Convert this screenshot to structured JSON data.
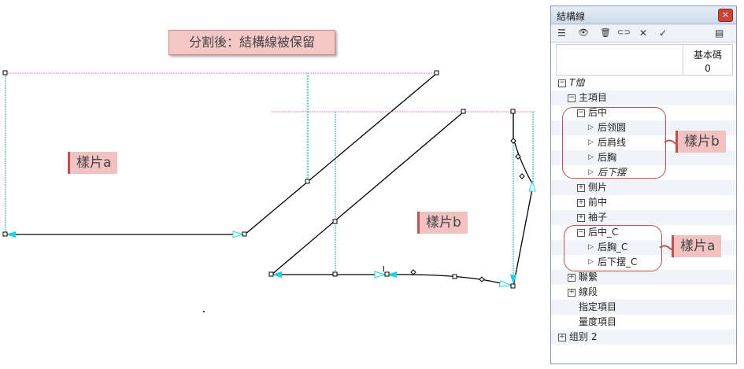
{
  "annotations": {
    "title": "分割後：結構線被保留",
    "piece_a_canvas": "樣片a",
    "piece_b_canvas": "樣片b",
    "piece_b_panel": "樣片b",
    "piece_a_panel": "樣片a"
  },
  "panel": {
    "title": "結構線",
    "close": "×",
    "toolbar": {
      "list": "☰",
      "eye": "👁",
      "trash": "🗑",
      "link": "⊂⊃",
      "delete": "✕",
      "check": "✓",
      "menu": "▤"
    },
    "column": {
      "label": "基本碼",
      "value": "0"
    },
    "tree": [
      {
        "label": "T恤",
        "level": 0,
        "type": "minus",
        "italic": true
      },
      {
        "label": "主項目",
        "level": 1,
        "type": "minus"
      },
      {
        "label": "后中",
        "level": 2,
        "type": "minus"
      },
      {
        "label": "后领圆",
        "level": 3,
        "type": "tri"
      },
      {
        "label": "后肩线",
        "level": 3,
        "type": "tri"
      },
      {
        "label": "后胸",
        "level": 3,
        "type": "tri"
      },
      {
        "label": "后下摆",
        "level": 3,
        "type": "tri",
        "italic": true
      },
      {
        "label": "侧片",
        "level": 2,
        "type": "plus"
      },
      {
        "label": "前中",
        "level": 2,
        "type": "plus"
      },
      {
        "label": "袖子",
        "level": 2,
        "type": "plus"
      },
      {
        "label": "后中_C",
        "level": 2,
        "type": "minus"
      },
      {
        "label": "后胸_C",
        "level": 3,
        "type": "tri"
      },
      {
        "label": "后下摆_C",
        "level": 3,
        "type": "tri"
      },
      {
        "label": "聯繫",
        "level": 1,
        "type": "plus"
      },
      {
        "label": "線段",
        "level": 1,
        "type": "plus"
      },
      {
        "label": "指定項目",
        "level": 1,
        "type": "none"
      },
      {
        "label": "量度項目",
        "level": 1,
        "type": "none"
      },
      {
        "label": "组别 2",
        "level": 0,
        "type": "plus"
      }
    ]
  }
}
